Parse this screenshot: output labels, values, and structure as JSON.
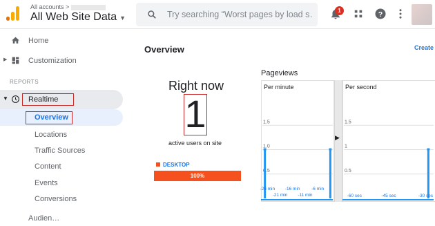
{
  "header": {
    "account_label": "All accounts >",
    "property_name": "All Web Site Data",
    "search_placeholder": "Try searching “Worst pages by load s…",
    "notification_count": "1"
  },
  "sidebar": {
    "home": "Home",
    "customization": "Customization",
    "section": "REPORTS",
    "realtime": "Realtime",
    "sub_items": [
      "Overview",
      "Locations",
      "Traffic Sources",
      "Content",
      "Events",
      "Conversions"
    ],
    "audience_partial": "Audien…"
  },
  "main": {
    "title": "Overview",
    "create_link": "Create",
    "right_now": "Right now",
    "active_users": "1",
    "active_users_label": "active users on site",
    "device_label": "DESKTOP",
    "device_percent": "100%",
    "pageviews_title": "Pageviews",
    "per_minute": "Per minute",
    "per_second": "Per second"
  },
  "chart_data": [
    {
      "type": "bar",
      "title": "Per minute",
      "y_ticks": [
        "1.5",
        "1.0",
        "0.5"
      ],
      "ylim": [
        0,
        2
      ],
      "x_ticks_top": [
        "-26 min",
        "-16 min",
        "-6 min"
      ],
      "x_ticks_bottom": [
        "-21 min",
        "-11 min"
      ],
      "x": [
        -27,
        -1
      ],
      "values": [
        1,
        1
      ]
    },
    {
      "type": "bar",
      "title": "Per second",
      "y_ticks": [
        "1.5",
        "1",
        "0.5"
      ],
      "ylim": [
        0,
        2
      ],
      "x_ticks": [
        "-60 sec",
        "-45 sec",
        "-30 sec"
      ],
      "x": [
        -30
      ],
      "values": [
        1
      ]
    }
  ],
  "colors": {
    "accent": "#1a73e8",
    "device_bar": "#f4511e",
    "bar": "#2196f3",
    "annotation": "#c62828"
  }
}
